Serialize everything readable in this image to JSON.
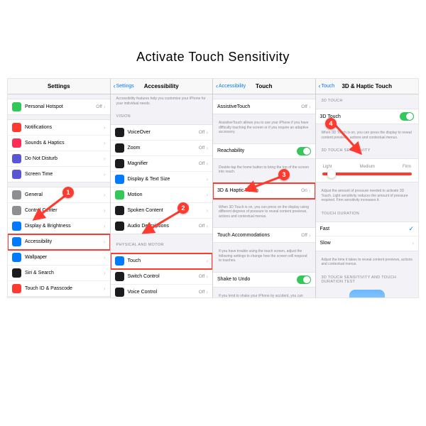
{
  "title": "Activate Touch Sensitivity",
  "badges": [
    "1",
    "2",
    "3",
    "4"
  ],
  "panel1": {
    "header": "Settings",
    "rows": [
      {
        "label": "Personal Hotspot",
        "detail": "Off",
        "icon": "c-green"
      },
      {
        "label": "Notifications",
        "icon": "c-red"
      },
      {
        "label": "Sounds & Haptics",
        "icon": "c-pink"
      },
      {
        "label": "Do Not Disturb",
        "icon": "c-purple"
      },
      {
        "label": "Screen Time",
        "icon": "c-purple"
      },
      {
        "label": "General",
        "icon": "c-gray"
      },
      {
        "label": "Control Center",
        "icon": "c-gray"
      },
      {
        "label": "Display & Brightness",
        "icon": "c-blue"
      },
      {
        "label": "Accessibility",
        "icon": "c-blue",
        "hl": true
      },
      {
        "label": "Wallpaper",
        "icon": "c-blue"
      },
      {
        "label": "Siri & Search",
        "icon": "c-black"
      },
      {
        "label": "Touch ID & Passcode",
        "icon": "c-red"
      }
    ]
  },
  "panel2": {
    "back": "Settings",
    "header": "Accessibility",
    "intro": "Accessibility features help you customize your iPhone for your individual needs.",
    "g1": "VISION",
    "rows1": [
      {
        "label": "VoiceOver",
        "detail": "Off",
        "icon": "c-black"
      },
      {
        "label": "Zoom",
        "detail": "Off",
        "icon": "c-black"
      },
      {
        "label": "Magnifier",
        "detail": "Off",
        "icon": "c-black"
      },
      {
        "label": "Display & Text Size",
        "icon": "c-blue"
      },
      {
        "label": "Motion",
        "icon": "c-green"
      },
      {
        "label": "Spoken Content",
        "icon": "c-black"
      },
      {
        "label": "Audio Descriptions",
        "detail": "Off",
        "icon": "c-black"
      }
    ],
    "g2": "PHYSICAL AND MOTOR",
    "rows2": [
      {
        "label": "Touch",
        "icon": "c-blue",
        "hl": true
      },
      {
        "label": "Switch Control",
        "detail": "Off",
        "icon": "c-black"
      },
      {
        "label": "Voice Control",
        "detail": "Off",
        "icon": "c-black"
      }
    ]
  },
  "panel3": {
    "back": "Accessibility",
    "header": "Touch",
    "assistive": {
      "label": "AssistiveTouch",
      "detail": "Off"
    },
    "assistive_note": "AssistiveTouch allows you to use your iPhone if you have difficulty touching the screen or if you require an adaptive accessory.",
    "reach": {
      "label": "Reachability"
    },
    "reach_note": "Double-tap the home button to bring the top of the screen into reach.",
    "haptic": {
      "label": "3D & Haptic Touch",
      "detail": "On"
    },
    "haptic_note": "When 3D Touch is on, you can press on the display using different degrees of pressure to reveal content previews, actions and contextual menus.",
    "accom": {
      "label": "Touch Accommodations",
      "detail": "Off"
    },
    "accom_note": "If you have trouble using the touch screen, adjust the following settings to change how the screen will respond to touches.",
    "shake": {
      "label": "Shake to Undo"
    },
    "shake_note": "If you tend to shake your iPhone by accident, you can disable Shake to Undo to prevent the Undo alert from"
  },
  "panel4": {
    "back": "Touch",
    "header": "3D & Haptic Touch",
    "g1": "3D TOUCH",
    "toggle": {
      "label": "3D Touch"
    },
    "toggle_note": "When 3D Touch is on, you can press the display to reveal content previews, actions and contextual menus.",
    "g2": "3D TOUCH SENSITIVITY",
    "seg": [
      "Light",
      "Medium",
      "Firm"
    ],
    "slider_note": "Adjust the amount of pressure needed to activate 3D Touch. Light sensitivity reduces the amount of pressure required. Firm sensitivity increases it.",
    "g3": "TOUCH DURATION",
    "dur": [
      {
        "label": "Fast",
        "sel": true
      },
      {
        "label": "Slow"
      }
    ],
    "dur_note": "Adjust the time it takes to reveal content previews, actions and contextual menus.",
    "g4": "3D TOUCH SENSITIVITY AND TOUCH DURATION TEST"
  }
}
